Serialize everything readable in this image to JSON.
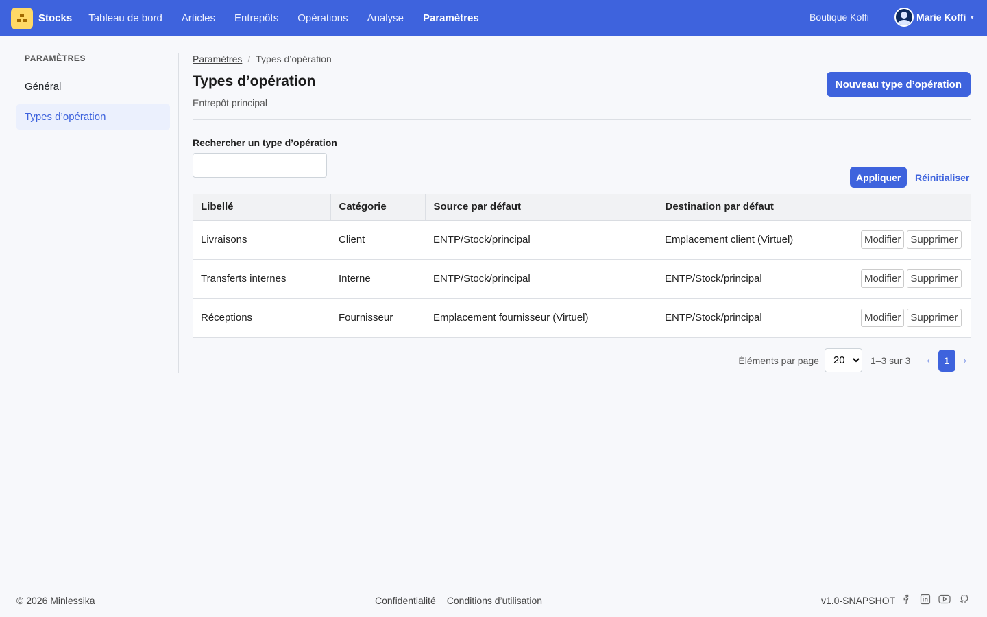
{
  "brand": {
    "name": "Stocks"
  },
  "nav": {
    "items": [
      {
        "label": "Tableau de bord"
      },
      {
        "label": "Articles"
      },
      {
        "label": "Entrepôts"
      },
      {
        "label": "Opérations"
      },
      {
        "label": "Analyse"
      },
      {
        "label": "Paramètres"
      }
    ],
    "org": "Boutique Koffi",
    "user": "Marie Koffi"
  },
  "sidebar": {
    "title": "PARAMÈTRES",
    "items": [
      {
        "label": "Général"
      },
      {
        "label": "Types d’opération"
      }
    ]
  },
  "breadcrumb": {
    "parent": "Paramètres",
    "sep": "/",
    "current": "Types d’opération"
  },
  "page": {
    "title": "Types d’opération",
    "subtitle": "Entrepôt principal",
    "new_button": "Nouveau type d’opération"
  },
  "search": {
    "label": "Rechercher un type d’opération",
    "value": "",
    "placeholder": "",
    "apply": "Appliquer",
    "reset": "Réinitialiser"
  },
  "table": {
    "headers": [
      "Libellé",
      "Catégorie",
      "Source par défaut",
      "Destination par défaut",
      ""
    ],
    "rows": [
      {
        "label": "Livraisons",
        "category": "Client",
        "source": "ENTP/Stock/principal",
        "destination": "Emplacement client (Virtuel)"
      },
      {
        "label": "Transferts internes",
        "category": "Interne",
        "source": "ENTP/Stock/principal",
        "destination": "ENTP/Stock/principal"
      },
      {
        "label": "Réceptions",
        "category": "Fournisseur",
        "source": "Emplacement fournisseur (Virtuel)",
        "destination": "ENTP/Stock/principal"
      }
    ],
    "edit_label": "Modifier",
    "delete_label": "Supprimer"
  },
  "pagination": {
    "per_page_label": "Éléments par page",
    "per_page_value": "20",
    "range": "1–3 sur 3",
    "prev": "‹",
    "current_page": "1",
    "next": "›"
  },
  "footer": {
    "copyright": "© 2026 Minlessika",
    "links": [
      "Confidentialité",
      "Conditions d’utilisation"
    ],
    "version": "v1.0-SNAPSHOT",
    "social_icons": [
      "facebook-icon",
      "linkedin-icon",
      "youtube-icon",
      "github-icon"
    ]
  },
  "colors": {
    "accent": "#3e63dd",
    "brand_logo": "#ffd966"
  }
}
